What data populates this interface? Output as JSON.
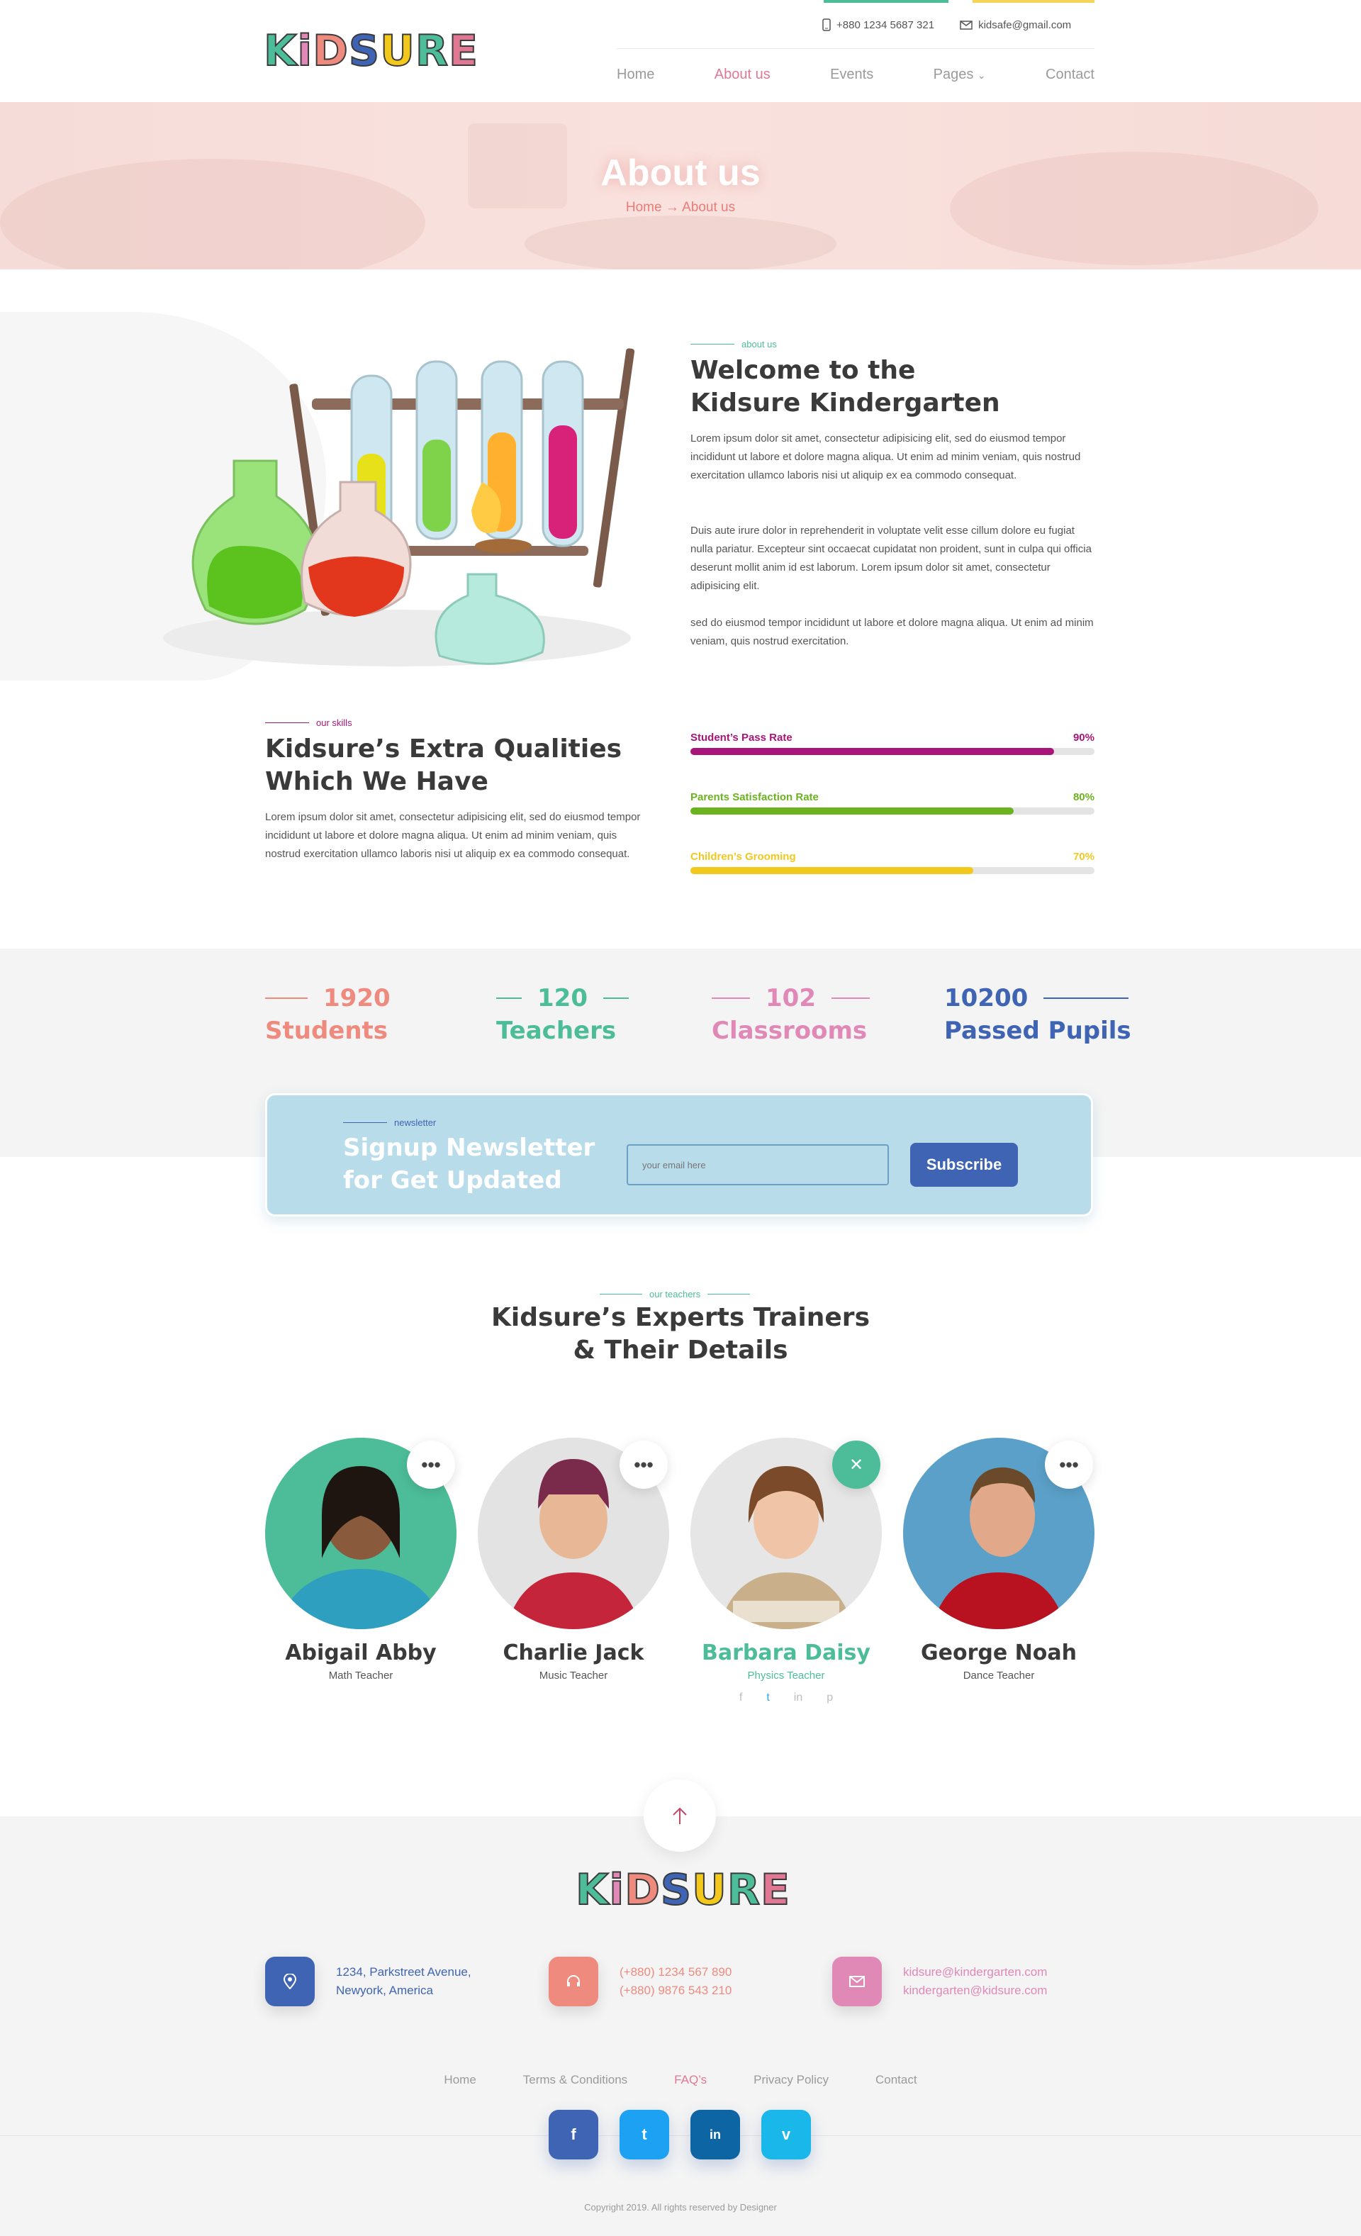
{
  "brand": {
    "logo_text": "KiDSURE"
  },
  "topbar": {
    "phone": "+880 1234 5687 321",
    "email": "kidsafe@gmail.com"
  },
  "nav": {
    "items": [
      "Home",
      "About us",
      "Events",
      "Pages",
      "Contact"
    ],
    "active": "About us"
  },
  "hero": {
    "title": "About us",
    "breadcrumb_home": "Home",
    "breadcrumb_arrow": "→",
    "breadcrumb_current": "About us"
  },
  "about": {
    "eyebrow": "about us",
    "title_line1": "Welcome to the",
    "title_line2": "Kidsure Kindergarten",
    "para1": "Lorem ipsum dolor sit amet, consectetur adipisicing elit, sed do eiusmod tempor incididunt ut labore et dolore magna aliqua. Ut enim ad minim veniam, quis nostrud exercitation ullamco laboris nisi ut aliquip ex ea commodo consequat.",
    "para2": "Duis aute irure dolor in reprehenderit in voluptate velit esse cillum dolore eu fugiat nulla pariatur. Excepteur sint occaecat cupidatat non proident, sunt in culpa qui officia deserunt mollit anim id est laborum. Lorem ipsum dolor sit amet, consectetur adipisicing elit.",
    "para3": "sed do eiusmod tempor incididunt ut labore et dolore magna aliqua. Ut enim ad minim veniam, quis nostrud exercitation."
  },
  "skills": {
    "eyebrow": "our skills",
    "title_line1": "Kidsure’s Extra Qualities",
    "title_line2": "Which We Have",
    "para": "Lorem ipsum dolor sit amet, consectetur adipisicing elit, sed do eiusmod tempor incididunt ut labore et dolore magna aliqua. Ut enim ad minim veniam, quis nostrud exercitation ullamco laboris nisi ut aliquip ex ea commodo consequat.",
    "bars": [
      {
        "label": "Student’s Pass Rate",
        "value_text": "90%",
        "value": 0.9,
        "color": "#a8157a"
      },
      {
        "label": "Parents Satisfaction Rate",
        "value_text": "80%",
        "value": 0.8,
        "color": "#6bb31e"
      },
      {
        "label": "Children’s Grooming",
        "value_text": "70%",
        "value": 0.7,
        "color": "#f2c81d"
      }
    ]
  },
  "stats": [
    {
      "number": "1920",
      "label": "Students",
      "color": "#ef8a7f"
    },
    {
      "number": "120",
      "label": "Teachers",
      "color": "#4cbd98"
    },
    {
      "number": "102",
      "label": "Classrooms",
      "color": "#e089b7"
    },
    {
      "number": "10200",
      "label": "Passed Pupils",
      "color": "#3f64b3"
    }
  ],
  "newsletter": {
    "eyebrow": "newsletter",
    "title_line1": "Signup Newsletter",
    "title_line2": "for Get Updated",
    "placeholder": "your email here",
    "button": "Subscribe"
  },
  "teachers": {
    "eyebrow": "our teachers",
    "title_line1": "Kidsure’s Experts Trainers",
    "title_line2": "& Their Details",
    "items": [
      {
        "name": "Abigail Abby",
        "role": "Math Teacher"
      },
      {
        "name": "Charlie Jack",
        "role": "Music Teacher"
      },
      {
        "name": "Barbara Daisy",
        "role": "Physics Teacher"
      },
      {
        "name": "George Noah",
        "role": "Dance Teacher"
      }
    ],
    "more_glyph": "•••",
    "close_glyph": "✕",
    "social_glyphs": [
      "f",
      "t",
      "in",
      "p"
    ]
  },
  "footer": {
    "logo_text": "KiDSURE",
    "address_line1": "1234, Parkstreet Avenue,",
    "address_line2": "Newyork, America",
    "phone1": "(+880) 1234 567 890",
    "phone2": "(+880) 9876 543 210",
    "email1": "kidsure@kindergarten.com",
    "email2": "kindergarten@kidsure.com",
    "links": [
      "Home",
      "Terms & Conditions",
      "FAQ’s",
      "Privacy Policy",
      "Contact"
    ],
    "active_link": "FAQ’s",
    "social": [
      "f",
      "t",
      "in",
      "v"
    ],
    "copyright": "Copyright 2019. All rights reserved by Designer"
  },
  "colors": {
    "accent_pink": "#e17893",
    "accent_green": "#4cbd98",
    "accent_blue": "#3f64b3",
    "hero_bg": "#f8dfdb"
  }
}
